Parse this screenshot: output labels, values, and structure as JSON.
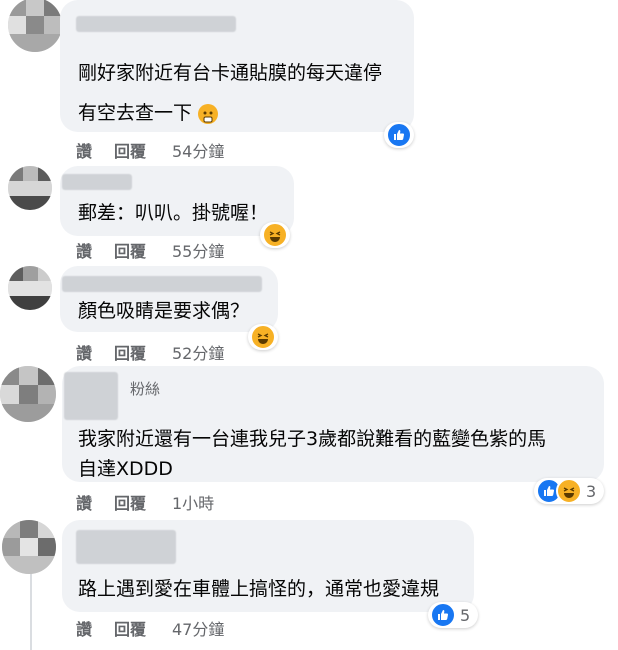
{
  "actions": {
    "like": "讚",
    "reply": "回覆"
  },
  "comments": [
    {
      "text_lines": [
        "剛好家附近有台卡通貼膜的每天違停",
        "有空去查一下"
      ],
      "time": "54分鐘",
      "reactions": [],
      "count": ""
    },
    {
      "text_lines": [
        "郵差：叭叭。掛號喔！"
      ],
      "time": "55分鐘",
      "reactions": [
        "haha"
      ],
      "count": ""
    },
    {
      "text_lines": [
        "顏色吸睛是要求偶？"
      ],
      "time": "52分鐘",
      "reactions": [
        "haha"
      ],
      "count": ""
    },
    {
      "badge": "粉絲",
      "text_lines": [
        "我家附近還有一台連我兒子3歲都說難看的藍變色紫的馬",
        "自達XDDD"
      ],
      "time": "1小時",
      "reactions": [
        "like",
        "haha"
      ],
      "count": "3"
    },
    {
      "text_lines": [
        "路上遇到愛在車體上搞怪的，通常也愛違規"
      ],
      "time": "47分鐘",
      "reactions": [
        "like"
      ],
      "count": "5"
    }
  ],
  "colors": {
    "bubble": "#f0f2f5",
    "like": "#1877f2",
    "haha": "#f7b125",
    "meta": "#65676b"
  }
}
